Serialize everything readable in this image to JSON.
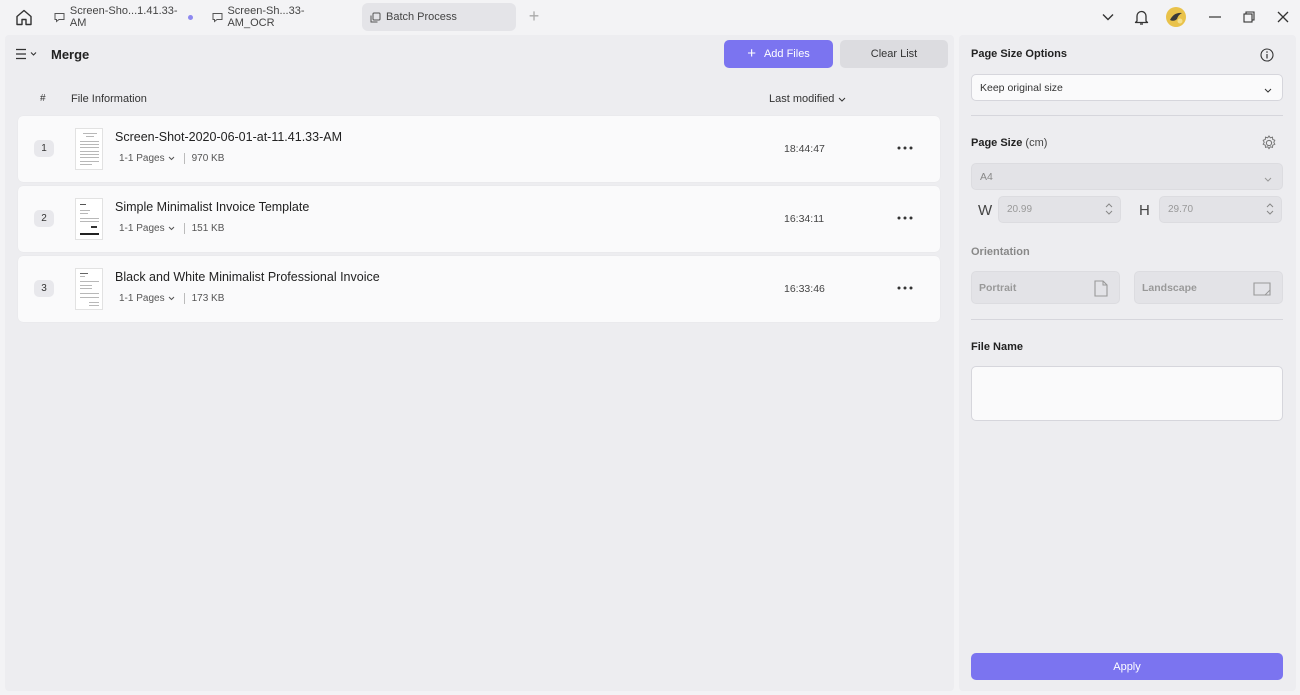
{
  "tabs": [
    {
      "label": "Screen-Sho...1.41.33-AM",
      "icon": "comment-icon",
      "modified": true
    },
    {
      "label": "Screen-Sh...33-AM_OCR",
      "icon": "comment-icon",
      "modified": false
    },
    {
      "label": "Batch Process",
      "icon": "copy-icon",
      "active": true
    }
  ],
  "header": {
    "title": "Merge",
    "add_files_label": "Add Files",
    "clear_list_label": "Clear List"
  },
  "columns": {
    "number": "#",
    "info": "File Information",
    "modified": "Last modified"
  },
  "files": [
    {
      "index": "1",
      "name": "Screen-Shot-2020-06-01-at-11.41.33-AM",
      "pages": "1-1 Pages",
      "size": "970 KB",
      "time": "18:44:47"
    },
    {
      "index": "2",
      "name": "Simple Minimalist Invoice Template",
      "pages": "1-1 Pages",
      "size": "151 KB",
      "time": "16:34:11"
    },
    {
      "index": "3",
      "name": "Black and White Minimalist Professional Invoice",
      "pages": "1-1 Pages",
      "size": "173 KB",
      "time": "16:33:46"
    }
  ],
  "sidebar": {
    "page_size_options_title": "Page Size Options",
    "page_size_option_value": "Keep original size",
    "page_size_title": "Page Size",
    "page_size_unit": "(cm)",
    "paper_value": "A4",
    "width_label": "W",
    "width_value": "20.99",
    "height_label": "H",
    "height_value": "29.70",
    "orientation_title": "Orientation",
    "portrait_label": "Portrait",
    "landscape_label": "Landscape",
    "file_name_title": "File Name",
    "file_name_value": "",
    "apply_label": "Apply"
  },
  "colors": {
    "accent": "#7b74f0",
    "panel": "#ededf0",
    "background": "#f3f3f5"
  }
}
